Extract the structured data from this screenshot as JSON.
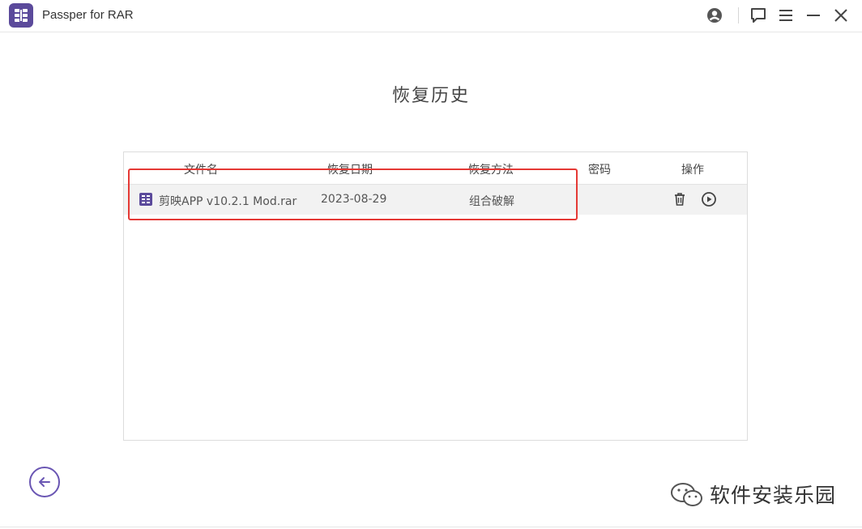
{
  "app": {
    "title": "Passper for RAR"
  },
  "page": {
    "title": "恢复历史"
  },
  "table": {
    "columns": {
      "filename": "文件名",
      "date": "恢复日期",
      "method": "恢复方法",
      "password": "密码",
      "actions": "操作"
    },
    "rows": [
      {
        "filename": "剪映APP v10.2.1 Mod.rar",
        "date": "2023-08-29",
        "method": "组合破解",
        "password": ""
      }
    ]
  },
  "watermark": {
    "text": "软件安装乐园"
  },
  "colors": {
    "brand": "#5b4a9b",
    "highlight": "#e53935",
    "row_bg": "#f2f2f2"
  },
  "icons": {
    "window": [
      "account-icon",
      "feedback-icon",
      "menu-icon",
      "minimize-icon",
      "close-icon"
    ],
    "row_actions": [
      "trash-icon",
      "play-icon"
    ],
    "nav": "back-arrow-icon"
  }
}
